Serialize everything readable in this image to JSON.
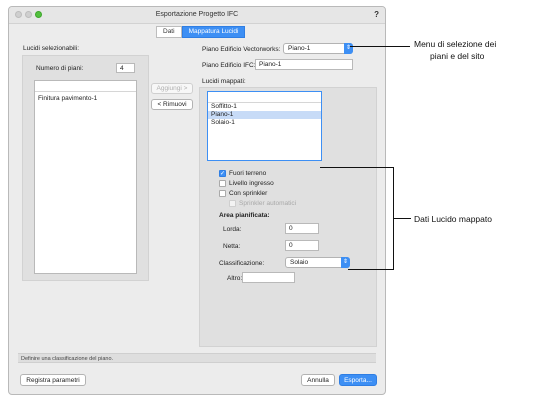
{
  "window": {
    "title": "Esportazione Progetto IFC",
    "help": "?"
  },
  "tabs": [
    {
      "label": "Dati",
      "active": false
    },
    {
      "label": "Mappatura Lucidi",
      "active": true
    }
  ],
  "left": {
    "heading": "Lucidi selezionabili:",
    "floors_label": "Numero di piani:",
    "floors_value": "4",
    "items": [
      "Finitura pavimento-1"
    ]
  },
  "buttons": {
    "add": "Aggiungi >",
    "remove": "< Rimuovi"
  },
  "right": {
    "vw_floor_label": "Piano Edificio Vectorworks:",
    "vw_floor_value": "Piano-1",
    "ifc_floor_label": "Piano Edificio IFC:",
    "ifc_floor_value": "Piano-1",
    "mapped_heading": "Lucidi mappati:",
    "mapped_items": [
      {
        "label": "Soffitto-1",
        "selected": false
      },
      {
        "label": "Piano-1",
        "selected": true
      },
      {
        "label": "Solaio-1",
        "selected": false
      }
    ],
    "checkboxes": {
      "above_ground": {
        "label": "Fuori terreno",
        "checked": true
      },
      "entrance": {
        "label": "Livello ingresso",
        "checked": false
      },
      "sprinkler": {
        "label": "Con sprinkler",
        "checked": false
      },
      "sprinkler_auto": {
        "label": "Sprinkler automatici",
        "checked": false,
        "disabled": true
      }
    },
    "area_heading": "Area pianificata:",
    "gross_label": "Lorda:",
    "gross_value": "0",
    "net_label": "Netta:",
    "net_value": "0",
    "class_label": "Classificazione:",
    "class_value": "Solaio",
    "other_label": "Altro:",
    "other_value": ""
  },
  "status": "Definire una classificazione del piano.",
  "footer": {
    "save_params": "Registra parametri",
    "cancel": "Annulla",
    "export": "Esporta..."
  },
  "annotations": {
    "menu": [
      "Menu di selezione dei",
      "piani e del sito"
    ],
    "data": "Dati Lucido mappato"
  },
  "colors": {
    "accent": "#3d8ff4",
    "selection": "#c7dbf7"
  }
}
